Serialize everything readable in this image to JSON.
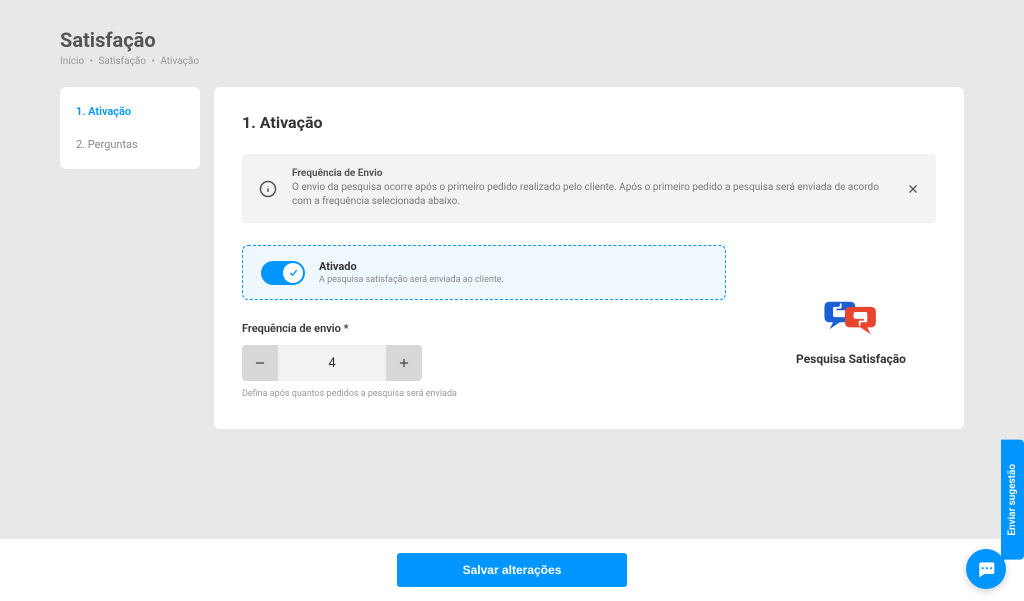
{
  "header": {
    "title": "Satisfação",
    "breadcrumb": {
      "item1": "Início",
      "item2": "Satisfação",
      "item3": "Ativação"
    }
  },
  "sidebar": {
    "items": [
      {
        "label": "1.  Ativação",
        "active": true
      },
      {
        "label": "2.  Perguntas",
        "active": false
      }
    ]
  },
  "main": {
    "section_title": "1. Ativação",
    "info": {
      "title": "Frequência de Envio",
      "desc": "O envio da pesquisa ocorre após o primeiro pedido realizado pelo cliente. Após o primeiro pedido a pesquisa será enviada de acordo com a frequência selecionada abaixo."
    },
    "toggle": {
      "title": "Ativado",
      "desc": "A pesquisa satisfação será enviada ao cliente.",
      "on": true
    },
    "frequency": {
      "label": "Frequência de envio *",
      "value": "4",
      "hint": "Defina após quantos pedidos a pesquisa será enviada"
    },
    "pesquisa_label": "Pesquisa Satisfação"
  },
  "footer": {
    "save_label": "Salvar alterações"
  },
  "feedback_tab": "Enviar sugestão"
}
